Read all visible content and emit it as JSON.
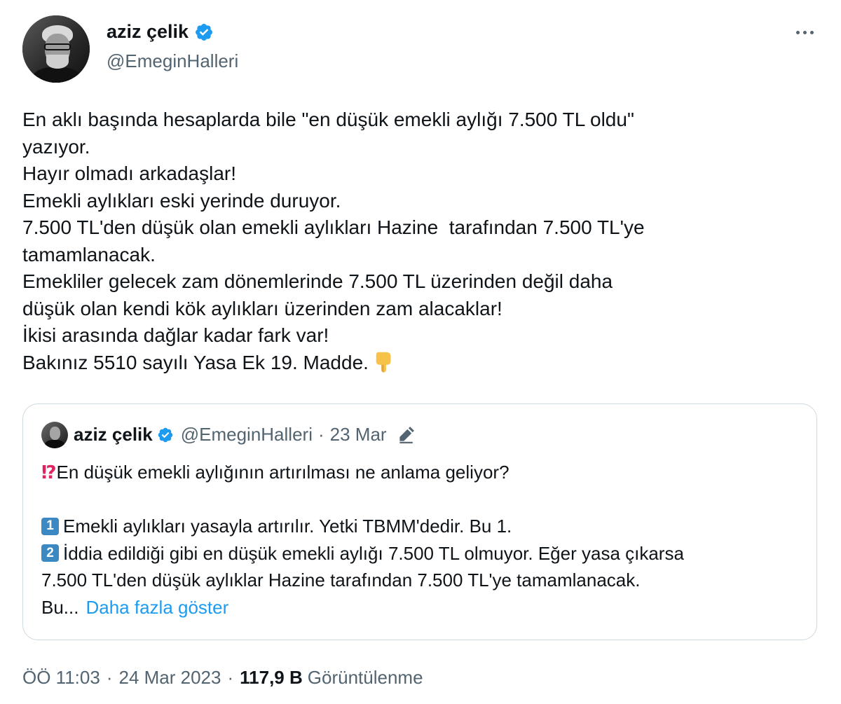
{
  "author": {
    "display_name": "aziz çelik",
    "handle": "@EmeginHalleri",
    "verified": true,
    "avatar_icon": "profile-photo"
  },
  "tweet": {
    "lines": [
      "En aklı başında hesaplarda bile \"en düşük emekli aylığı 7.500 TL oldu\"",
      "yazıyor.",
      "Hayır olmadı arkadaşlar!",
      "Emekli aylıkları eski yerinde duruyor.",
      "7.500 TL'den düşük olan emekli aylıkları Hazine  tarafından 7.500 TL'ye",
      "tamamlanacak.",
      "Emekliler gelecek zam dönemlerinde 7.500 TL üzerinden değil daha",
      "düşük olan kendi kök aylıkları üzerinden zam alacaklar!",
      "İkisi arasında dağlar kadar fark var!",
      "Bakınız 5510 sayılı Yasa Ek 19. Madde."
    ],
    "trailing_emoji": "backhand-index-pointing-down"
  },
  "quote": {
    "display_name": "aziz çelik",
    "handle": "@EmeginHalleri",
    "separator": "·",
    "date": "23 Mar",
    "edited_icon": "edit-pencil-icon",
    "line1_emoji": "⁉",
    "line1": "En düşük emekli aylığının artırılması ne anlama geliyor?",
    "item1_key": "1",
    "item1": "Emekli aylıkları yasayla artırılır. Yetki TBMM'dedir. Bu 1.",
    "item2_key": "2",
    "item2": "İddia edildiği gibi en düşük emekli aylığı 7.500 TL olmuyor. Eğer yasa çıkarsa",
    "line4": "7.500 TL'den düşük aylıklar Hazine tarafından 7.500 TL'ye tamamlanacak.",
    "truncated": "Bu...",
    "show_more": "Daha fazla göster"
  },
  "meta": {
    "time": "ÖÖ 11:03",
    "separator": "·",
    "date": "24 Mar 2023",
    "views_count": "117,9 B",
    "views_label": "Görüntülenme"
  },
  "colors": {
    "text": "#0f1419",
    "secondary": "#536471",
    "link": "#1d9bf0",
    "border": "#cfd9de",
    "verified": "#1d9bf0"
  }
}
